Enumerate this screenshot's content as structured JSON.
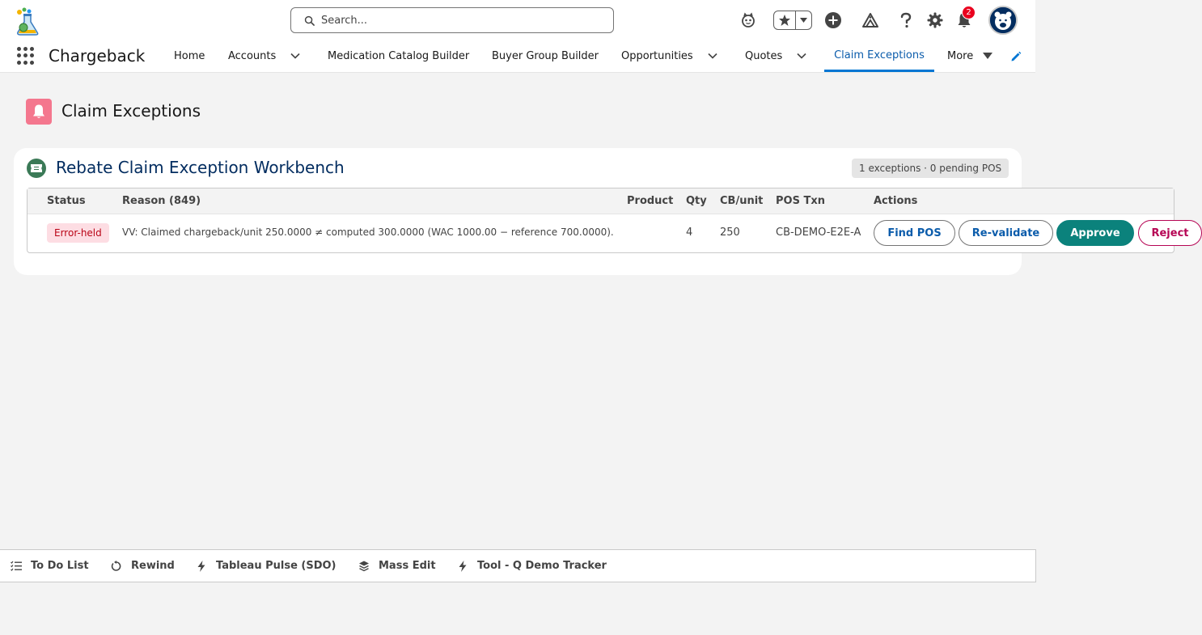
{
  "header": {
    "search_placeholder": "Search...",
    "notification_count": "2"
  },
  "nav": {
    "app_name": "Chargeback",
    "items": [
      {
        "label": "Home"
      },
      {
        "label": "Accounts"
      },
      {
        "label": "Medication Catalog Builder"
      },
      {
        "label": "Buyer Group Builder"
      },
      {
        "label": "Opportunities"
      },
      {
        "label": "Quotes"
      },
      {
        "label": "Claim Exceptions"
      },
      {
        "label": "More"
      }
    ]
  },
  "page": {
    "title": "Claim Exceptions"
  },
  "workbench": {
    "title": "Rebate Claim Exception Workbench",
    "summary": "1 exceptions · 0 pending POS",
    "columns": [
      "Status",
      "Reason (849)",
      "Product",
      "Qty",
      "CB/unit",
      "POS Txn",
      "Actions"
    ],
    "rows": [
      {
        "status": "Error-held",
        "reason": "VV: Claimed chargeback/unit 250.0000 ≠ computed 300.0000 (WAC 1000.00 − reference 700.0000).",
        "product": "",
        "qty": "4",
        "cb_unit": "250",
        "pos_txn": "CB-DEMO-E2E-A",
        "actions": {
          "find_pos": "Find POS",
          "revalidate": "Re-validate",
          "approve": "Approve",
          "reject": "Reject"
        }
      }
    ]
  },
  "utility_bar": {
    "items": [
      {
        "label": "To Do List",
        "icon": "checklist-icon"
      },
      {
        "label": "Rewind",
        "icon": "rewind-icon"
      },
      {
        "label": "Tableau Pulse (SDO)",
        "icon": "lightning-icon"
      },
      {
        "label": "Mass Edit",
        "icon": "layers-icon"
      },
      {
        "label": "Tool - Q Demo Tracker",
        "icon": "lightning-icon"
      }
    ]
  },
  "colors": {
    "brand_blue": "#0176d3",
    "approve_teal": "#0b827c",
    "reject_magenta": "#b60554",
    "page_icon_pink": "#f4778e",
    "status_error_bg": "#fddde3"
  }
}
